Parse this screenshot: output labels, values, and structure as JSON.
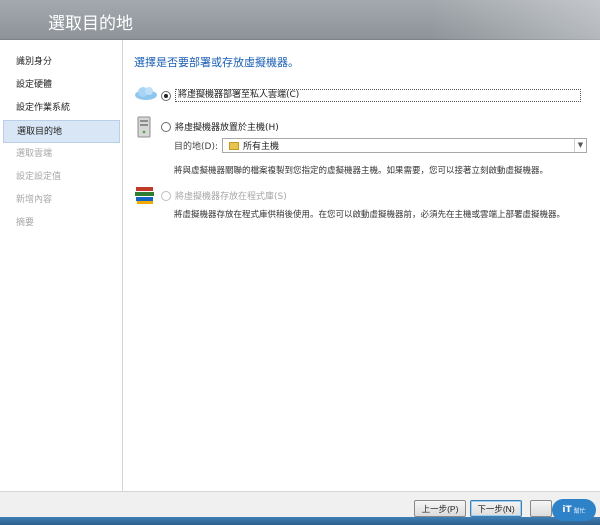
{
  "window": {
    "title": "選取目的地"
  },
  "sidebar": {
    "items": [
      {
        "label": "識別身分",
        "state": "normal"
      },
      {
        "label": "設定硬體",
        "state": "normal"
      },
      {
        "label": "設定作業系統",
        "state": "normal"
      },
      {
        "label": "選取目的地",
        "state": "active"
      },
      {
        "label": "選取雲端",
        "state": "disabled"
      },
      {
        "label": "設定設定值",
        "state": "disabled"
      },
      {
        "label": "新增內容",
        "state": "disabled"
      },
      {
        "label": "摘要",
        "state": "disabled"
      }
    ]
  },
  "main": {
    "heading": "選擇是否要部署或存放虛擬機器。",
    "options": [
      {
        "label": "將虛擬機器部署至私人雲端(C)",
        "checked": true,
        "enabled": true,
        "icon": "cloud-icon"
      },
      {
        "label": "將虛擬機器放置於主機(H)",
        "checked": false,
        "enabled": true,
        "icon": "server-icon"
      },
      {
        "label": "將虛擬機器存放在程式庫(S)",
        "checked": false,
        "enabled": false,
        "icon": "library-books-icon"
      }
    ],
    "destination": {
      "label": "目的地(D):",
      "value": "所有主機"
    },
    "host_description": "將與虛擬機器關聯的檔案複製到您指定的虛擬機器主機。如果需要，您可以接著立刻啟動虛擬機器。",
    "library_description": "將虛擬機器存放在程式庫供稍後使用。在您可以啟動虛擬機器前，必須先在主機或雲端上部署虛擬機器。"
  },
  "footer": {
    "back_label": "上一步(P)",
    "next_label": "下一步(N)"
  },
  "watermark": {
    "text": "iT",
    "sub": "幫忙"
  },
  "colors": {
    "accent": "#1a5fb4",
    "title_bar": "#9aa0a5",
    "selected_item": "#d9e6f5"
  }
}
